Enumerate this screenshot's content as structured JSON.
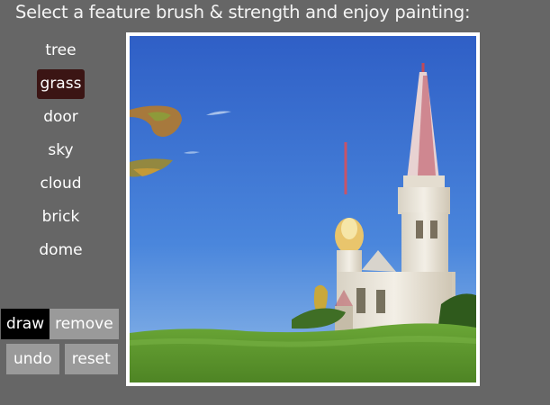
{
  "instruction": "Select a feature brush & strength and enjoy painting:",
  "brushes": [
    {
      "label": "tree",
      "selected": false
    },
    {
      "label": "grass",
      "selected": true
    },
    {
      "label": "door",
      "selected": false
    },
    {
      "label": "sky",
      "selected": false
    },
    {
      "label": "cloud",
      "selected": false
    },
    {
      "label": "brick",
      "selected": false
    },
    {
      "label": "dome",
      "selected": false
    }
  ],
  "modes": {
    "draw_label": "draw",
    "remove_label": "remove",
    "active": "draw"
  },
  "actions": {
    "undo_label": "undo",
    "reset_label": "reset"
  },
  "colors": {
    "background": "#666666",
    "selected_brush": "#3b1514",
    "active_mode": "#000000",
    "button_gray": "#9a9a9a",
    "sky": "#3c6fd0",
    "grass": "#5f9a2c"
  }
}
